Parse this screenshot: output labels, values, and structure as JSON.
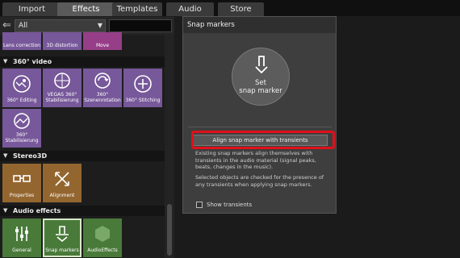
{
  "tabs": [
    {
      "label": "Import"
    },
    {
      "label": "Effects",
      "active": true
    },
    {
      "label": "Templates"
    },
    {
      "label": "Audio"
    },
    {
      "label": "Store"
    }
  ],
  "toolbar": {
    "back_icon": "arrow-left-icon",
    "filter_value": "All",
    "search_placeholder": ""
  },
  "top_row": [
    {
      "label": "Lens correction"
    },
    {
      "label": "3D distortion"
    },
    {
      "label": "Move"
    }
  ],
  "sections": {
    "video360": {
      "title": "360° video"
    },
    "stereo3d": {
      "title": "Stereo3D"
    },
    "audio_effects": {
      "title": "Audio effects"
    }
  },
  "video360_tiles": [
    {
      "label": "360° Editing"
    },
    {
      "label": "VEGAS 360° Stabilisierung"
    },
    {
      "label": "360° Szenenrotation"
    },
    {
      "label": "360° Stitching"
    },
    {
      "label": "360° Stabilisierung"
    }
  ],
  "stereo3d_tiles": [
    {
      "label": "Properties"
    },
    {
      "label": "Alignment"
    }
  ],
  "audio_tiles": [
    {
      "label": "General"
    },
    {
      "label": "Snap markers",
      "selected": true
    },
    {
      "label": "AudioEffects"
    }
  ],
  "panel": {
    "title": "Snap markers",
    "set_label_1": "Set",
    "set_label_2": "snap marker",
    "align_button": "Align snap marker with transients",
    "desc1_line1": "Existing snap markers align themselves with",
    "desc1_line2": "transients in the audio material (signal peaks,",
    "desc1_line3": "beats, changes in the music).",
    "desc2_line1": "Selected objects are checked for the presence of",
    "desc2_line2": "any transients when applying snap markers.",
    "show_transients": "Show transients",
    "show_transients_checked": false
  },
  "colors": {
    "video_tile": "#77589a",
    "stereo_tile": "#94662f",
    "audio_tile": "#4a7a3a",
    "highlight_box": "#e0101a"
  }
}
